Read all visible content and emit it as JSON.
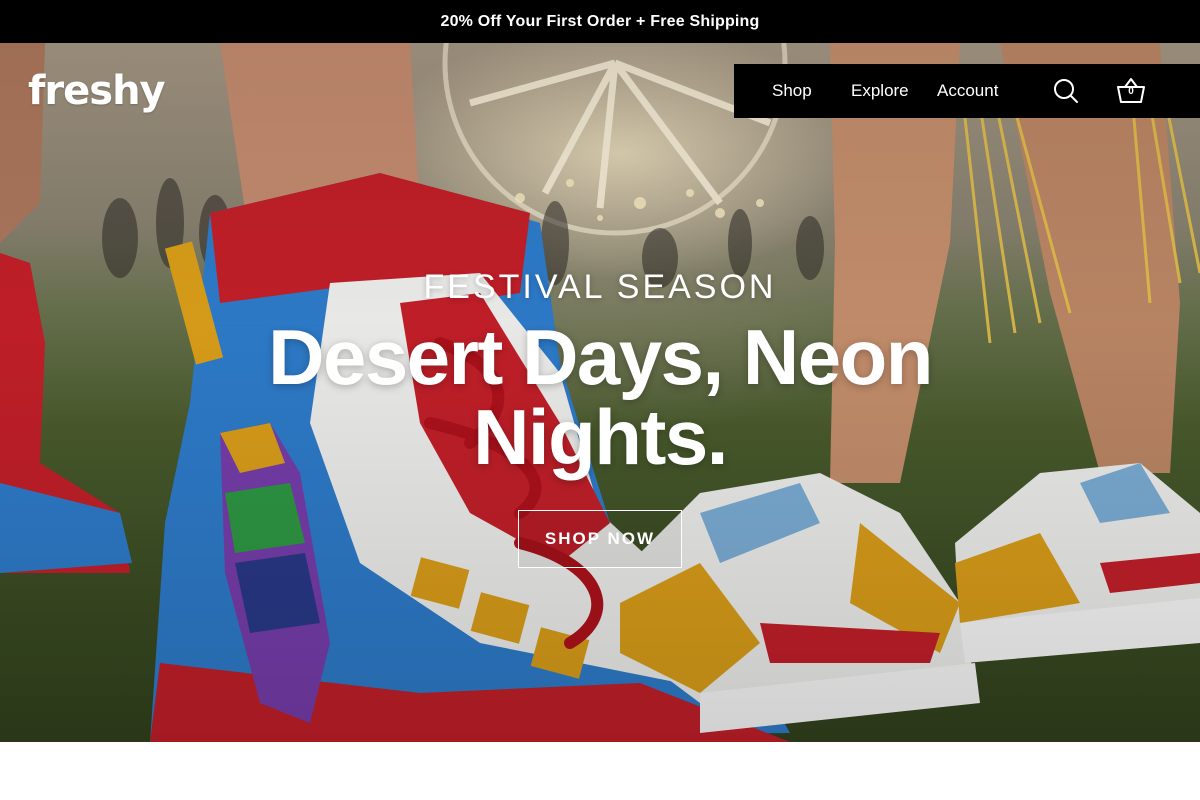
{
  "announcement": {
    "text": "20% Off Your First Order + Free Shipping"
  },
  "header": {
    "logo_text": "freshy",
    "nav": [
      {
        "label": "Shop"
      },
      {
        "label": "Explore"
      },
      {
        "label": "Account"
      }
    ],
    "search_icon": "search-icon",
    "cart_icon": "basket-icon",
    "cart_count": "0"
  },
  "hero": {
    "eyebrow": "FESTIVAL SEASON",
    "headline": "Desert Days, Neon Nights.",
    "cta_label": "SHOP NOW",
    "background_description_colors": {
      "grass": "#4c5e2e",
      "sky": "#a99a86",
      "boot_red": "#c8202a",
      "boot_blue": "#2f7fd0",
      "sneaker_yellow": "#e0a21a"
    }
  },
  "colors": {
    "bar_bg": "#000000",
    "text_on_dark": "#ffffff",
    "page_bg": "#ffffff"
  }
}
